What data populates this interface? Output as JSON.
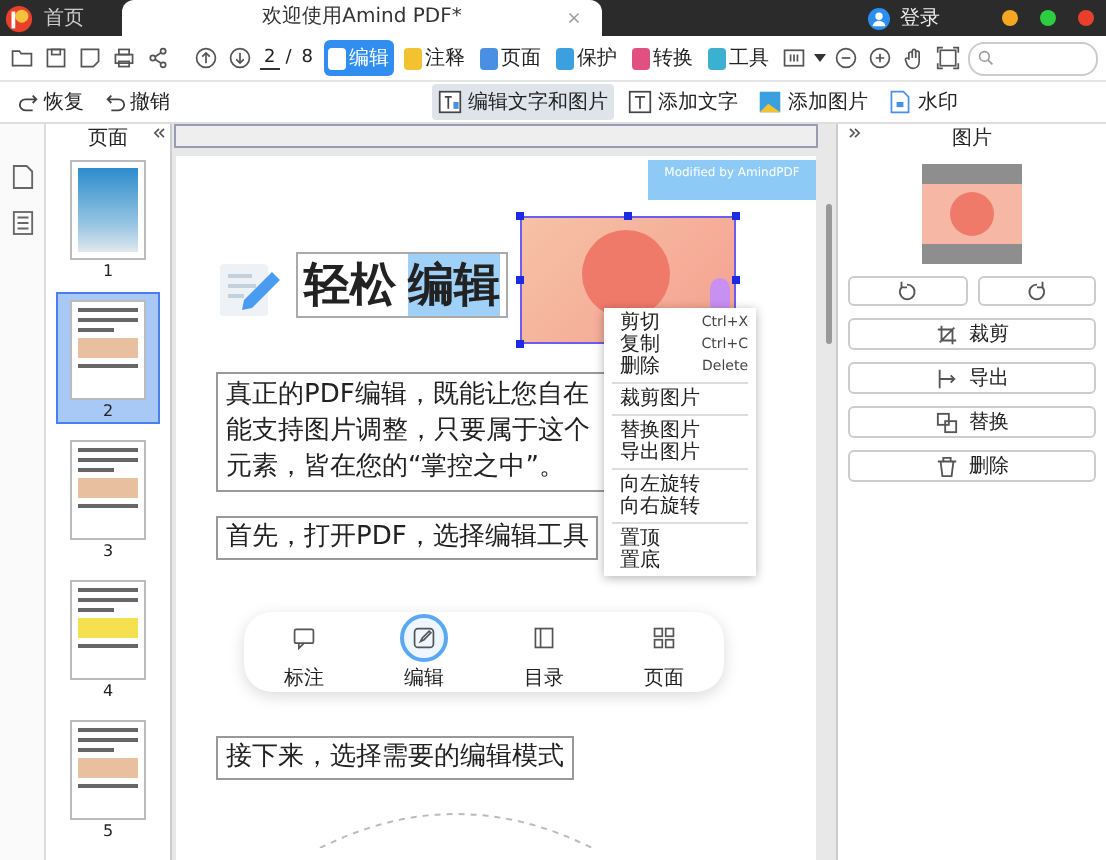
{
  "title_bar": {
    "home_tab": "首页",
    "document_tab": "欢迎使用Amind PDF*",
    "login": "登录"
  },
  "toolbar": {
    "page_current": "2",
    "page_separator": "/",
    "page_total": "8",
    "modes": [
      {
        "label": "编辑",
        "selected": true
      },
      {
        "label": "注释",
        "selected": false
      },
      {
        "label": "页面",
        "selected": false
      },
      {
        "label": "保护",
        "selected": false
      },
      {
        "label": "转换",
        "selected": false
      },
      {
        "label": "工具",
        "selected": false
      }
    ]
  },
  "edit_toolbar": {
    "redo": "恢复",
    "undo": "撤销",
    "tools": [
      {
        "label": "编辑文字和图片",
        "selected": true,
        "kind": "text-image"
      },
      {
        "label": "添加文字",
        "selected": false,
        "kind": "text"
      },
      {
        "label": "添加图片",
        "selected": false,
        "kind": "image"
      },
      {
        "label": "水印",
        "selected": false,
        "kind": "watermark"
      }
    ]
  },
  "pages_panel": {
    "title": "页面",
    "pages": [
      {
        "number": "1",
        "selected": false
      },
      {
        "number": "2",
        "selected": true
      },
      {
        "number": "3",
        "selected": false
      },
      {
        "number": "4",
        "selected": false
      },
      {
        "number": "5",
        "selected": false
      }
    ]
  },
  "document": {
    "watermark": "Modified by AmindPDF",
    "heading_plain": "轻松",
    "heading_selected": "编辑",
    "paragraph_lines": [
      "真正的PDF编辑，既能让您自在",
      "能支持图片调整，只要属于这个",
      "元素，皆在您的“掌控之中”。"
    ],
    "step_1": "首先，打开PDF，选择编辑工具",
    "feature_bar": [
      {
        "label": "标注",
        "selected": false,
        "kind": "comment"
      },
      {
        "label": "编辑",
        "selected": true,
        "kind": "edit"
      },
      {
        "label": "目录",
        "selected": false,
        "kind": "outline"
      },
      {
        "label": "页面",
        "selected": false,
        "kind": "pages"
      }
    ],
    "step_2": "接下来，选择需要的编辑模式"
  },
  "context_menu": {
    "groups": [
      [
        {
          "label": "剪切",
          "shortcut": "Ctrl+X"
        },
        {
          "label": "复制",
          "shortcut": "Ctrl+C"
        },
        {
          "label": "删除",
          "shortcut": "Delete"
        }
      ],
      [
        {
          "label": "裁剪图片"
        }
      ],
      [
        {
          "label": "替换图片"
        },
        {
          "label": "导出图片"
        }
      ],
      [
        {
          "label": "向左旋转"
        },
        {
          "label": "向右旋转"
        }
      ],
      [
        {
          "label": "置顶"
        },
        {
          "label": "置底"
        }
      ]
    ]
  },
  "properties_panel": {
    "title": "图片",
    "actions": [
      {
        "label": "裁剪",
        "kind": "crop"
      },
      {
        "label": "导出",
        "kind": "export"
      },
      {
        "label": "替换",
        "kind": "replace"
      },
      {
        "label": "删除",
        "kind": "delete"
      }
    ]
  }
}
